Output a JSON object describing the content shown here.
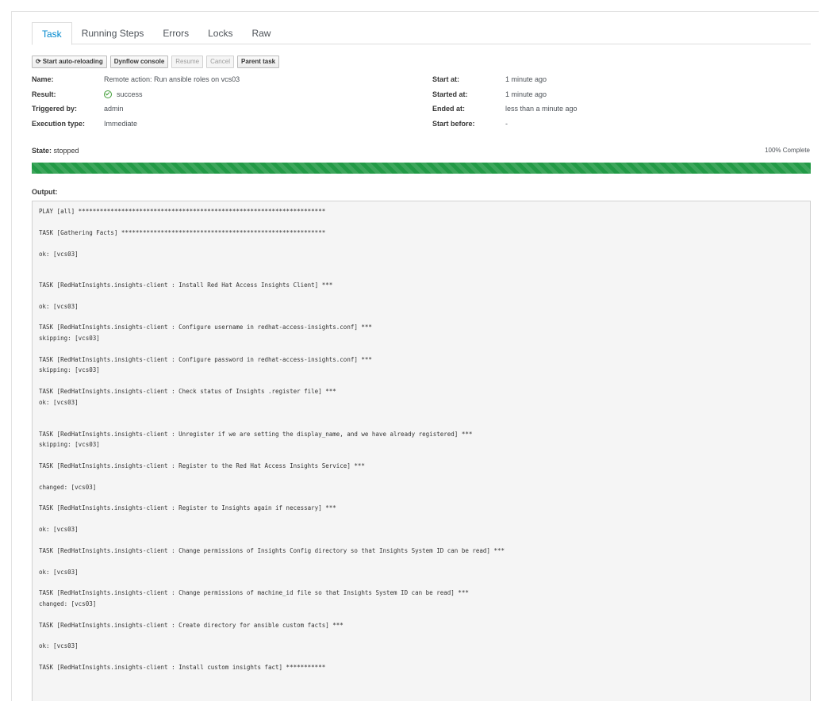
{
  "tabs": [
    {
      "label": "Task",
      "active": true
    },
    {
      "label": "Running Steps",
      "active": false
    },
    {
      "label": "Errors",
      "active": false
    },
    {
      "label": "Locks",
      "active": false
    },
    {
      "label": "Raw",
      "active": false
    }
  ],
  "toolbar": {
    "auto_reload_label": "Start auto-reloading",
    "dynflow_label": "Dynflow console",
    "resume_label": "Resume",
    "cancel_label": "Cancel",
    "parent_label": "Parent task"
  },
  "details_left": {
    "name_label": "Name:",
    "name_value": "Remote action: Run ansible roles on vcs03",
    "result_label": "Result:",
    "result_value": "success",
    "triggered_label": "Triggered by:",
    "triggered_value": "admin",
    "exec_label": "Execution type:",
    "exec_value": "Immediate"
  },
  "details_right": {
    "start_at_label": "Start at:",
    "start_at_value": "1 minute ago",
    "started_at_label": "Started at:",
    "started_at_value": "1 minute ago",
    "ended_at_label": "Ended at:",
    "ended_at_value": "less than a minute ago",
    "start_before_label": "Start before:",
    "start_before_value": "-"
  },
  "state": {
    "label": "State:",
    "value": "stopped",
    "complete_text": "100% Complete",
    "progress": 1.0
  },
  "colors": {
    "accent": "#0088ce",
    "progress": "#229a46",
    "success": "#3f9c35"
  },
  "output": {
    "label": "Output:",
    "lines": [
      "PLAY [all] *********************************************************************",
      "TASK [Gathering Facts] *********************************************************",
      "ok: [vcs03]",
      "TASK [RedHatInsights.insights-client : Install Red Hat Access Insights Client] ***",
      "ok: [vcs03]",
      "TASK [RedHatInsights.insights-client : Configure username in redhat-access-insights.conf] ***",
      "skipping: [vcs03]",
      "TASK [RedHatInsights.insights-client : Configure password in redhat-access-insights.conf] ***",
      "skipping: [vcs03]",
      "TASK [RedHatInsights.insights-client : Check status of Insights .register file] ***",
      "ok: [vcs03]",
      "TASK [RedHatInsights.insights-client : Unregister if we are setting the display_name, and we have already registered] ***",
      "skipping: [vcs03]",
      "TASK [RedHatInsights.insights-client : Register to the Red Hat Access Insights Service] ***",
      "changed: [vcs03]",
      "TASK [RedHatInsights.insights-client : Register to Insights again if necessary] ***",
      "ok: [vcs03]",
      "TASK [RedHatInsights.insights-client : Change permissions of Insights Config directory so that Insights System ID can be read] ***",
      "ok: [vcs03]",
      "TASK [RedHatInsights.insights-client : Change permissions of machine_id file so that Insights System ID can be read] ***",
      "changed: [vcs03]",
      "TASK [RedHatInsights.insights-client : Create directory for ansible custom facts] ***",
      "ok: [vcs03]",
      "TASK [RedHatInsights.insights-client : Install custom insights fact] ***********"
    ]
  }
}
